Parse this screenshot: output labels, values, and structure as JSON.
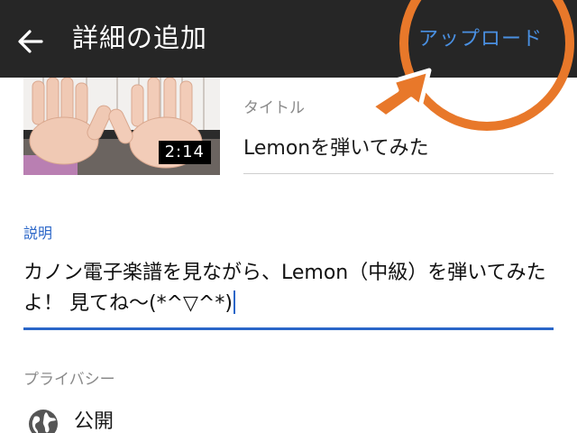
{
  "header": {
    "back_icon": "arrow-left-icon",
    "title": "詳細の追加",
    "upload_label": "アップロード",
    "background_color": "#262626",
    "upload_color": "#4a90e2"
  },
  "video": {
    "duration": "2:14"
  },
  "form": {
    "title_label": "タイトル",
    "title_value": "Lemonを弾いてみた",
    "description_label": "説明",
    "description_value": "カノン電子楽譜を見ながら、Lemon（中級）を弾いてみたよ！ 見てね〜(*^▽^*)",
    "privacy_label": "プライバシー",
    "privacy_icon": "globe-icon",
    "privacy_value": "公開",
    "accent_color": "#2a66c8"
  },
  "annotation": {
    "color": "#e8782a"
  }
}
